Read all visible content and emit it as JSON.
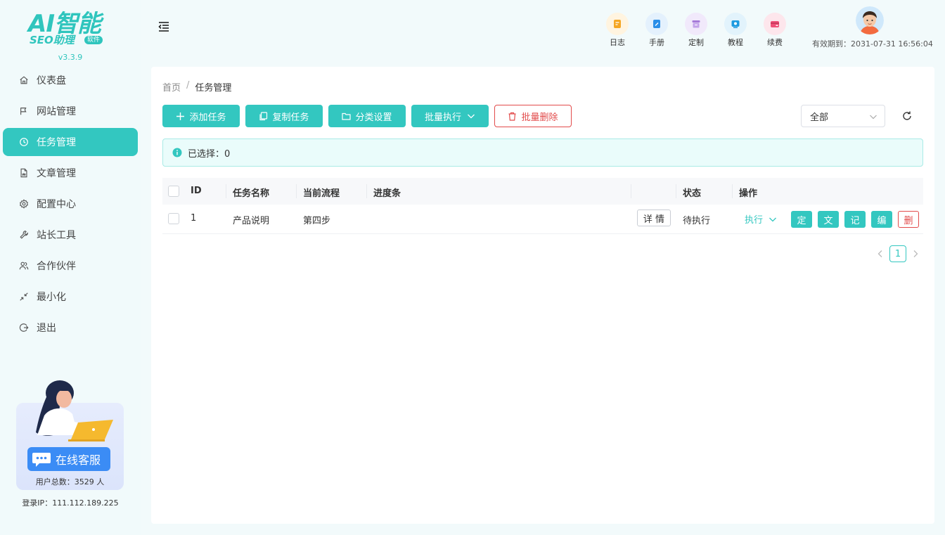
{
  "brand": {
    "logo_main": "AI智能",
    "logo_sub": "SEO助理",
    "logo_badge": "软件",
    "version": "v3.3.9",
    "accent_color": "#33c7c0",
    "danger_color": "#e24b4b"
  },
  "sidebar": {
    "items": [
      {
        "label": "仪表盘",
        "icon": "home-icon",
        "active": false
      },
      {
        "label": "网站管理",
        "icon": "flag-icon",
        "active": false
      },
      {
        "label": "任务管理",
        "icon": "clock-icon",
        "active": true
      },
      {
        "label": "文章管理",
        "icon": "document-icon",
        "active": false
      },
      {
        "label": "配置中心",
        "icon": "gear-icon",
        "active": false
      },
      {
        "label": "站长工具",
        "icon": "wrench-icon",
        "active": false
      },
      {
        "label": "合作伙伴",
        "icon": "users-icon",
        "active": false
      },
      {
        "label": "最小化",
        "icon": "minimize-icon",
        "active": false
      },
      {
        "label": "退出",
        "icon": "logout-icon",
        "active": false
      }
    ],
    "support_label": "在线客服",
    "user_count": "用户总数：3529 人",
    "login_ip": "登录IP：111.112.189.225"
  },
  "topbar": {
    "quick_links": [
      {
        "label": "日志",
        "icon": "log-icon",
        "color": "#f5a623",
        "bg": "#fff4e0"
      },
      {
        "label": "手册",
        "icon": "manual-icon",
        "color": "#2b8fe8",
        "bg": "#e4f1fd"
      },
      {
        "label": "定制",
        "icon": "custom-icon",
        "color": "#a57ad8",
        "bg": "#f1e9fb"
      },
      {
        "label": "教程",
        "icon": "tutorial-icon",
        "color": "#1e9be0",
        "bg": "#e2f3fc"
      },
      {
        "label": "续费",
        "icon": "renew-icon",
        "color": "#ef4f77",
        "bg": "#fde6ec"
      }
    ],
    "expiry": "有效期到：2031-07-31 16:56:04"
  },
  "breadcrumb": {
    "home": "首页",
    "separator": "/",
    "current": "任务管理"
  },
  "toolbar": {
    "add_label": "添加任务",
    "copy_label": "复制任务",
    "category_label": "分类设置",
    "batch_exec_label": "批量执行",
    "batch_delete_label": "批量删除",
    "filter_value": "全部"
  },
  "selection": {
    "text": "已选择：0"
  },
  "table": {
    "headers": {
      "id": "ID",
      "name": "任务名称",
      "step": "当前流程",
      "progress": "进度条",
      "status": "状态",
      "actions": "操作"
    },
    "rows": [
      {
        "id": "1",
        "name": "产品说明",
        "step": "第四步",
        "detail_label": "详 情",
        "status": "待执行",
        "exec_label": "执行",
        "btn_schedule": "定",
        "btn_article": "文",
        "btn_log": "记",
        "btn_edit": "编",
        "btn_delete": "删"
      }
    ]
  },
  "pagination": {
    "current_page": "1"
  }
}
